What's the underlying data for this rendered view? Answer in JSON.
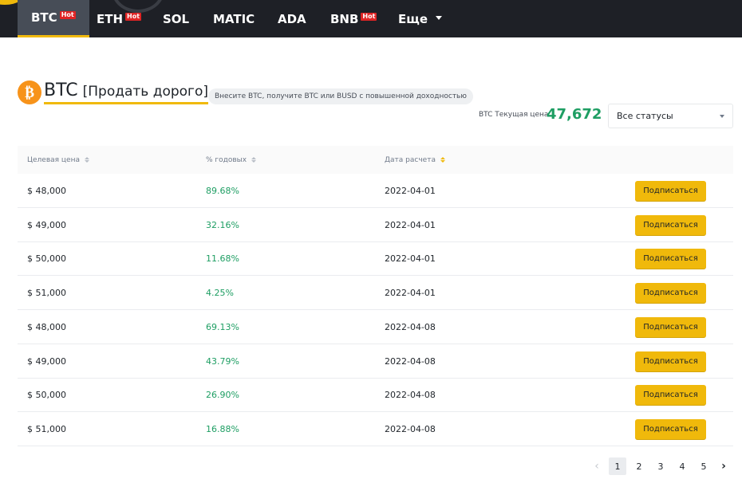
{
  "nav": {
    "tabs": [
      {
        "label": "BTC",
        "hot": "Hot",
        "active": true
      },
      {
        "label": "ETH",
        "hot": "Hot"
      },
      {
        "label": "SOL"
      },
      {
        "label": "MATIC"
      },
      {
        "label": "ADA"
      },
      {
        "label": "BNB",
        "hot": "Hot"
      },
      {
        "label": "Еще"
      }
    ]
  },
  "product": {
    "coin_glyph": "₿",
    "symbol": "BTC",
    "subtitle": "[Продать дорого]",
    "description": "Внесите BTC, получите BTC или BUSD с повышенной доходностью"
  },
  "price": {
    "label": "BTC Текущая цена",
    "value": "47,672"
  },
  "status_filter": {
    "selected": "Все статусы"
  },
  "table": {
    "headers": [
      "Целевая цена",
      "% годовых",
      "Дата расчета"
    ],
    "action_label": "Подписаться",
    "rows": [
      {
        "target": "$ 48,000",
        "apy": "89.68%",
        "date": "2022-04-01"
      },
      {
        "target": "$ 49,000",
        "apy": "32.16%",
        "date": "2022-04-01"
      },
      {
        "target": "$ 50,000",
        "apy": "11.68%",
        "date": "2022-04-01"
      },
      {
        "target": "$ 51,000",
        "apy": "4.25%",
        "date": "2022-04-01"
      },
      {
        "target": "$ 48,000",
        "apy": "69.13%",
        "date": "2022-04-08"
      },
      {
        "target": "$ 49,000",
        "apy": "43.79%",
        "date": "2022-04-08"
      },
      {
        "target": "$ 50,000",
        "apy": "26.90%",
        "date": "2022-04-08"
      },
      {
        "target": "$ 51,000",
        "apy": "16.88%",
        "date": "2022-04-08"
      }
    ]
  },
  "pagination": {
    "prev": "‹",
    "pages": [
      "1",
      "2",
      "3",
      "4",
      "5"
    ],
    "current": "1",
    "next": "›"
  },
  "colors": {
    "accent": "#f0b90b",
    "positive": "#1e9e63",
    "nav_bg": "#1e2026"
  }
}
